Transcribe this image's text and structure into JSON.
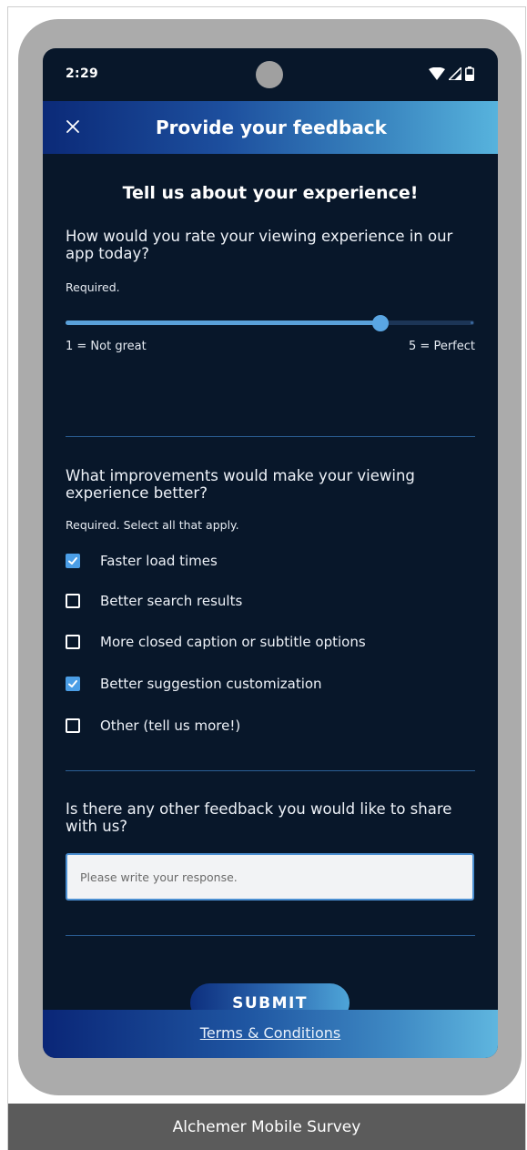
{
  "status_bar": {
    "time": "2:29",
    "icons": [
      "wifi-icon",
      "signal-icon",
      "battery-icon"
    ]
  },
  "app_bar": {
    "title": "Provide your feedback",
    "close_icon": "close-icon"
  },
  "survey": {
    "heading": "Tell us about your experience!",
    "q1": {
      "text": "How would you rate your viewing experience in our app today?",
      "required": "Required.",
      "min_label": "1 = Not great",
      "max_label": "5 = Perfect",
      "value_fraction": 0.77
    },
    "q2": {
      "text": "What improvements would make your viewing experience better?",
      "required": "Required. Select all that apply.",
      "options": [
        {
          "label": "Faster load times",
          "checked": true
        },
        {
          "label": "Better search results",
          "checked": false
        },
        {
          "label": "More closed caption or subtitle options",
          "checked": false
        },
        {
          "label": "Better suggestion customization",
          "checked": true
        },
        {
          "label": "Other (tell us more!)",
          "checked": false
        }
      ]
    },
    "q3": {
      "text": "Is there any other feedback you would like to share with us?",
      "placeholder": "Please write your response."
    },
    "submit_label": "SUBMIT"
  },
  "footer": {
    "terms_label": "Terms & Conditions"
  },
  "caption": "Alchemer Mobile Survey",
  "colors": {
    "screen_bg": "#08172a",
    "accent": "#4b9ee6",
    "device_frame": "#ababab",
    "caption_bg": "#5b5b5b"
  }
}
